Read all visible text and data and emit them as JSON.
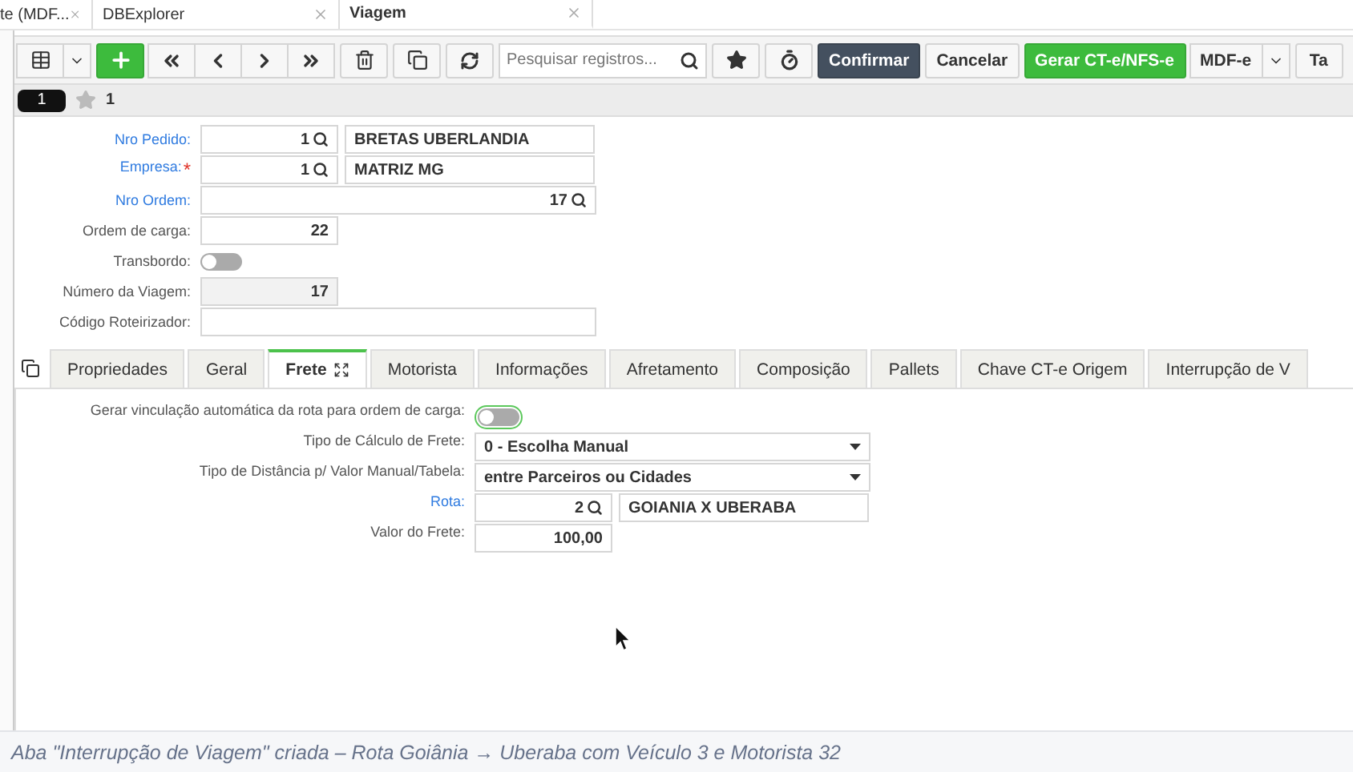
{
  "doc_tabs": [
    {
      "label": "te (MDF...",
      "selected": false
    },
    {
      "label": "DBExplorer",
      "selected": false
    },
    {
      "label": "Viagem",
      "selected": true
    }
  ],
  "toolbar": {
    "search": {
      "placeholder": "Pesquisar registros..."
    },
    "buttons": [
      {
        "label": "Confirmar",
        "kind": "dark"
      },
      {
        "label": "Cancelar",
        "kind": "plain"
      },
      {
        "label": "Gerar CT-e/NFS-e",
        "kind": "green"
      },
      {
        "label": "MDF-e",
        "kind": "split"
      },
      {
        "label": "Ta",
        "kind": "plain"
      }
    ]
  },
  "record_bar": {
    "record": "1",
    "favorites": "1"
  },
  "form": [
    {
      "label": "Nro Pedido:",
      "link": true,
      "kind": "lookup",
      "code": "1",
      "description": "BRETAS UBERLANDIA"
    },
    {
      "label": "Empresa:",
      "link": true,
      "required_mark": "*",
      "kind": "lookup",
      "code": "1",
      "description": "MATRIZ MG"
    },
    {
      "label": "Nro Ordem:",
      "link": true,
      "kind": "wide_lookup",
      "code": "17"
    },
    {
      "label": "Ordem de carga:",
      "kind": "number",
      "value": "22"
    },
    {
      "label": "Transbordo:",
      "kind": "toggle",
      "on": false
    },
    {
      "label": "Número da Viagem:",
      "kind": "readonly",
      "value": "17"
    },
    {
      "label": "Código Roteirizador:",
      "kind": "text"
    }
  ],
  "sub_tabs": [
    {
      "label": "Propriedades",
      "selected": false
    },
    {
      "label": "Geral",
      "selected": false
    },
    {
      "label": "Frete",
      "selected": true
    },
    {
      "label": "Motorista",
      "selected": false
    },
    {
      "label": "Informações",
      "selected": false
    },
    {
      "label": "Afretamento",
      "selected": false
    },
    {
      "label": "Composição",
      "selected": false
    },
    {
      "label": "Pallets",
      "selected": false
    },
    {
      "label": "Chave CT-e Origem",
      "selected": false
    },
    {
      "label": "Interrupção de V",
      "selected": false
    }
  ],
  "frete": [
    {
      "label": "Gerar vinculação automática da rota para ordem de carga:",
      "kind": "toggle",
      "on": false,
      "focused": true
    },
    {
      "label": "Tipo de Cálculo de Frete:",
      "kind": "select",
      "value": "0 - Escolha Manual"
    },
    {
      "label": "Tipo de Distância p/ Valor Manual/Tabela:",
      "kind": "select",
      "value": "entre Parceiros ou Cidades"
    },
    {
      "label": "Rota:",
      "link": true,
      "kind": "lookup",
      "code": "2",
      "description": "GOIANIA X UBERABA"
    },
    {
      "label": "Valor do Frete:",
      "kind": "number",
      "value": "100,00"
    }
  ],
  "caption": "Aba \"Interrupção de Viagem\" criada – Rota Goiânia → Uberaba com Veículo 3 e Motorista 32"
}
